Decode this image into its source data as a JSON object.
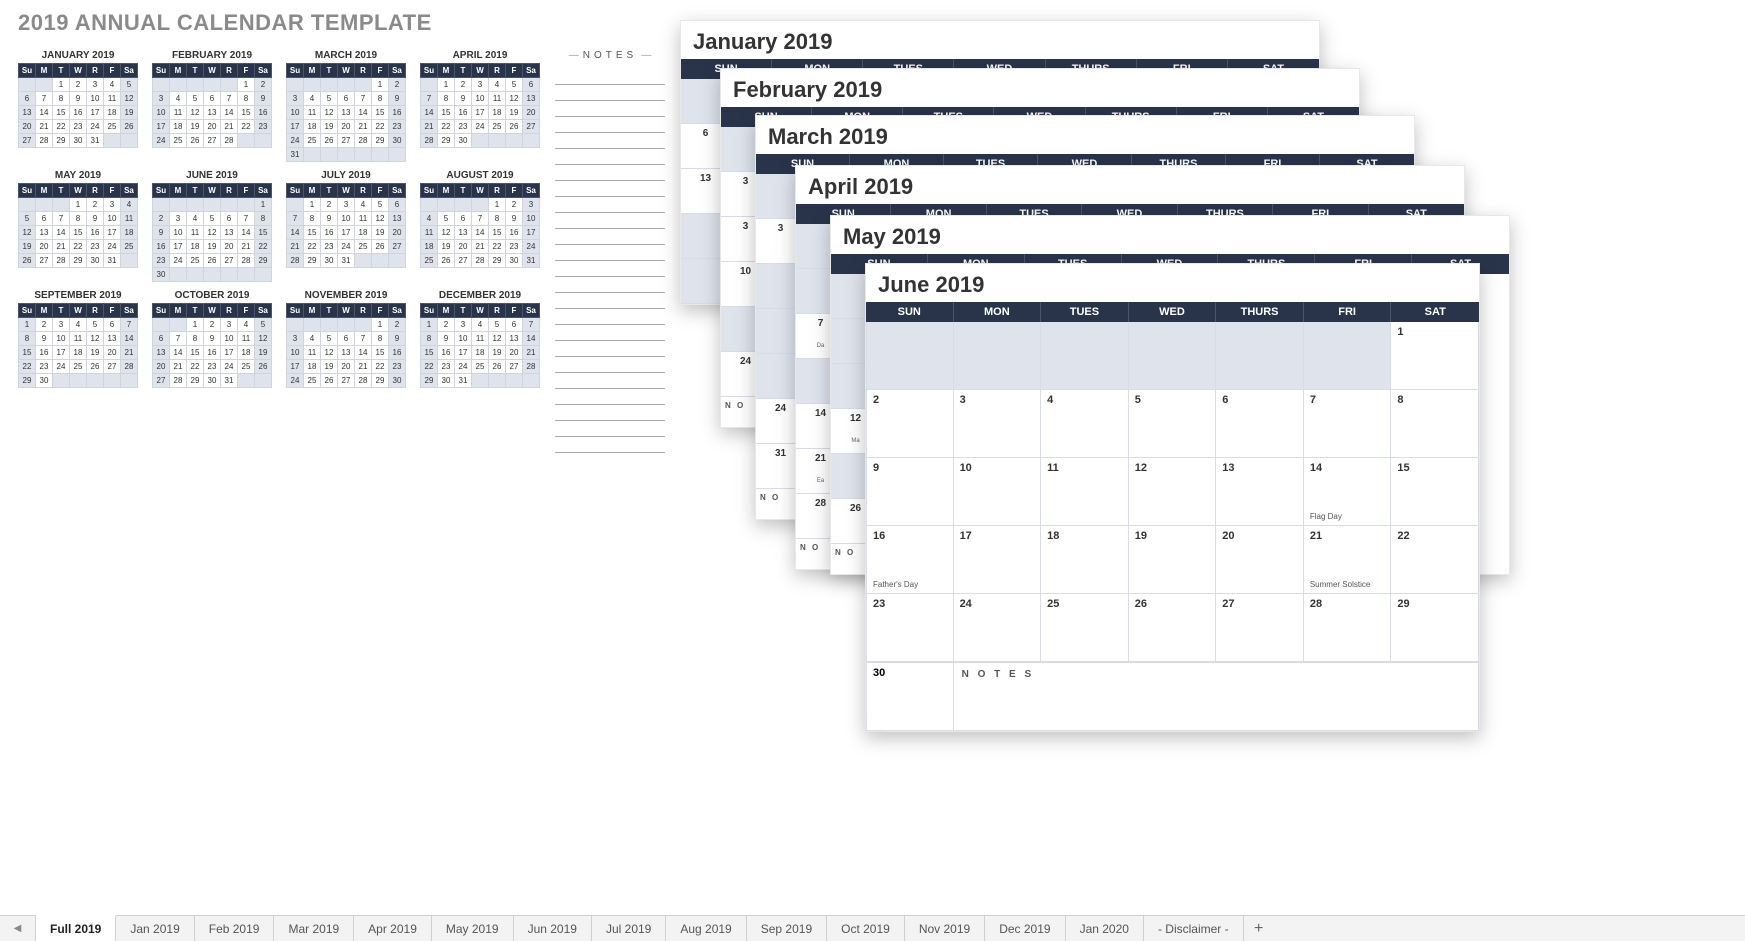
{
  "title": "2019 ANNUAL CALENDAR TEMPLATE",
  "notes_label": "NOTES",
  "day_headers_short": [
    "Su",
    "M",
    "T",
    "W",
    "R",
    "F",
    "Sa"
  ],
  "day_headers_long": [
    "SUN",
    "MON",
    "TUES",
    "WED",
    "THURS",
    "FRI",
    "SAT"
  ],
  "annual": [
    {
      "name": "JANUARY 2019",
      "start": 2,
      "days": 31
    },
    {
      "name": "FEBRUARY 2019",
      "start": 5,
      "days": 28
    },
    {
      "name": "MARCH 2019",
      "start": 5,
      "days": 31
    },
    {
      "name": "APRIL 2019",
      "start": 1,
      "days": 30
    },
    {
      "name": "MAY 2019",
      "start": 3,
      "days": 31
    },
    {
      "name": "JUNE 2019",
      "start": 6,
      "days": 30
    },
    {
      "name": "JULY 2019",
      "start": 1,
      "days": 31
    },
    {
      "name": "AUGUST 2019",
      "start": 4,
      "days": 31
    },
    {
      "name": "SEPTEMBER 2019",
      "start": 0,
      "days": 30
    },
    {
      "name": "OCTOBER 2019",
      "start": 2,
      "days": 31
    },
    {
      "name": "NOVEMBER 2019",
      "start": 5,
      "days": 30
    },
    {
      "name": "DECEMBER 2019",
      "start": 0,
      "days": 31
    }
  ],
  "stack": {
    "jan": {
      "title": "January 2019"
    },
    "feb": {
      "title": "February 2019"
    },
    "mar": {
      "title": "March 2019"
    },
    "apr": {
      "title": "April 2019"
    },
    "may": {
      "title": "May 2019"
    }
  },
  "strip_jan": [
    "",
    "6",
    "13",
    "",
    ""
  ],
  "strip_feb": [
    "",
    "3",
    "3",
    "10",
    "",
    "24",
    "NO"
  ],
  "strip_mar": [
    "",
    "3",
    "",
    "",
    "",
    "24",
    "31",
    "NO"
  ],
  "strip_apr": [
    "",
    "",
    "7",
    "",
    "14",
    "21",
    "28",
    "NO"
  ],
  "strip_may": [
    "",
    "",
    "",
    "12",
    "",
    "26",
    "NO"
  ],
  "strip_apr_ev": {
    "7": "Da",
    "14": "",
    "21": "Ea"
  },
  "strip_may_ev": {
    "12": "Ma"
  },
  "june": {
    "title": "June 2019",
    "start": 6,
    "days": 30,
    "last_day": "30",
    "notes_label": "N O T E S",
    "events": {
      "14": "Flag Day",
      "16": "Father's Day",
      "21": "Summer Solstice"
    }
  },
  "tabs": [
    "Full 2019",
    "Jan 2019",
    "Feb 2019",
    "Mar 2019",
    "Apr 2019",
    "May 2019",
    "Jun 2019",
    "Jul 2019",
    "Aug 2019",
    "Sep 2019",
    "Oct 2019",
    "Nov 2019",
    "Dec 2019",
    "Jan 2020",
    "- Disclaimer -"
  ],
  "active_tab": 0
}
